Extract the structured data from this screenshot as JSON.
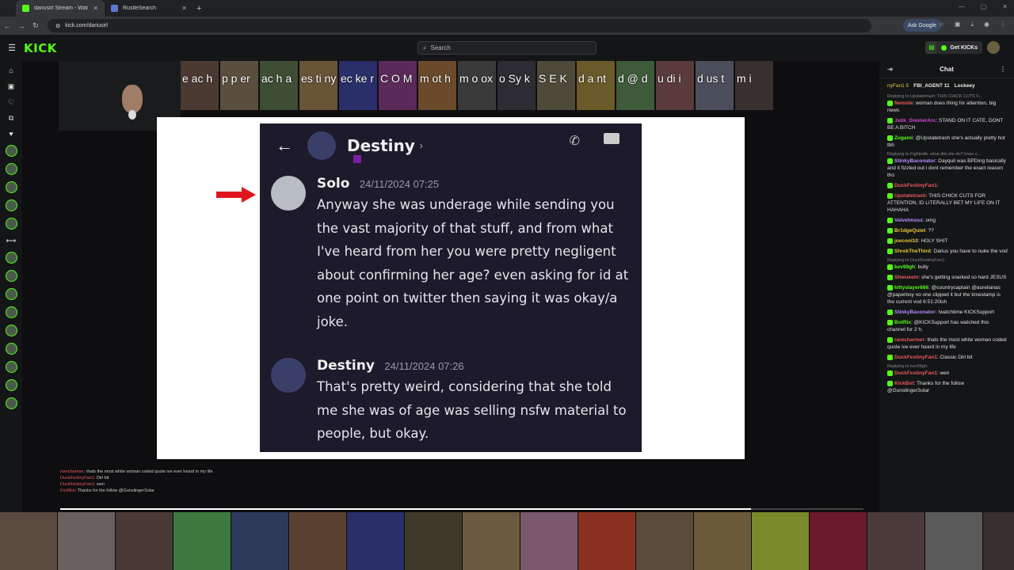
{
  "browser": {
    "tabs": [
      {
        "title": "dariusirl Stream - Watch Live o",
        "active": true
      },
      {
        "title": "RustleSearch",
        "active": false
      }
    ],
    "url": "kick.com/dariusirl",
    "ask_google": "Ask Google"
  },
  "kick": {
    "logo": "KICK",
    "search_placeholder": "Search",
    "get_kicks": "Get KICKs"
  },
  "stream": {
    "top_strip_letters": [
      "e ac h",
      "p p er",
      "ac h a",
      "es ti ny",
      "ec ke r",
      "C O M",
      "m ot h",
      "m o ox",
      "o Sy k",
      "S E K",
      "d a nt",
      "d @ d",
      "u di i",
      "d us t",
      "m i"
    ],
    "discord": {
      "header_name": "Destiny",
      "messages": [
        {
          "author": "Solo",
          "time": "24/11/2024 07:25",
          "text": "Anyway she was underage while sending you the vast majority of that stuff, and from what I've heard from her you were pretty negligent about confirming her age? even asking for id at one point on twitter then saying it was okay/a joke."
        },
        {
          "author": "Destiny",
          "time": "24/11/2024 07:26",
          "text": "That's pretty weird, considering that she told me she was of age was selling nsfw material to people, but okay."
        }
      ]
    },
    "overlay_chat": [
      {
        "user": "rarecharmer",
        "text": ": thats the most white woman coded quote ive ever heard in my life"
      },
      {
        "user": "DuckFestinyFan1",
        "text": ": Dirl bit"
      },
      {
        "user": "DuckFestinyFan1",
        "text": ": wen"
      },
      {
        "user": "KickBot",
        "text": ": Thanks for the follow @GunslingerSolar"
      }
    ],
    "progress": 0.86
  },
  "chat": {
    "title": "Chat",
    "pinned": [
      "nyFan1 5",
      "FBI_AGENT 11",
      "Lockeey"
    ],
    "messages": [
      {
        "reply": "Replying to Upstatetrash: THIS CHICK CUTS F...",
        "user": "Nemole",
        "color": "#e95a5a",
        "text": "woman does thing for attention, big news"
      },
      {
        "reply": "",
        "user": "Jstik_GoonerArc",
        "color": "#d14ad1",
        "text": "STAND ON IT CATE, DONT BE A BITCH"
      },
      {
        "reply": "",
        "user": "Zugami",
        "color": "#53fc18",
        "text": "@Upstatetrash she's actually pretty hot tbh"
      },
      {
        "reply": "Replying to Fightmilk: what did she do? lmao s...",
        "user": "StinkyBaconator",
        "color": "#b98aff",
        "text": "Dayquil was BPDing basically and it fizzled out i dont remember the exact reason tho"
      },
      {
        "reply": "",
        "user": "DuckFestinyFan1",
        "color": "#e95a5a",
        "text": ""
      },
      {
        "reply": "",
        "user": "Upstatetrash",
        "color": "#e95a5a",
        "text": "THIS CHICK CUTS FOR ATTENTION, ID LITERALLY BET MY LIFE ON IT HAHAHA"
      },
      {
        "reply": "",
        "user": "Velvetmoss",
        "color": "#b98aff",
        "text": "omg"
      },
      {
        "reply": "",
        "user": "Br1dgeQuiet",
        "color": "#e6c83a",
        "text": "??"
      },
      {
        "reply": "",
        "user": "joecool10",
        "color": "#e6c83a",
        "text": "HOLY SHIT"
      },
      {
        "reply": "",
        "user": "ShrekTheThird",
        "color": "#e6c83a",
        "text": "Darius you have to nuke the vod"
      },
      {
        "reply": "Replying to DuckFestinyFan1:",
        "user": "kev99gh",
        "color": "#53fc18",
        "text": "bully"
      },
      {
        "reply": "",
        "user": "Shwueem",
        "color": "#e95a5a",
        "text": "she's getting snarked so hard JESUS"
      },
      {
        "reply": "",
        "user": "kittyslayer666",
        "color": "#53fc18",
        "text": "@countrycaptain @aurelianas @paperboy no one clipped it but the timestamp is the current vod 6:51:20ish"
      },
      {
        "reply": "",
        "user": "StinkyBaconator",
        "color": "#b98aff",
        "text": "!watchtime KICKSupport"
      },
      {
        "reply": "",
        "user": "BotRix",
        "color": "#53fc18",
        "text": "@KICKSupport has watched this channel for 2 h."
      },
      {
        "reply": "",
        "user": "rarecharmer",
        "color": "#e95a5a",
        "text": "thats the most white woman coded quote ive ever heard in my life"
      },
      {
        "reply": "",
        "user": "DuckFestinyFan1",
        "color": "#e95a5a",
        "text": "Classic Dirl bit"
      },
      {
        "reply": "Replying to kev99gh:",
        "user": "DuckFestinyFan1",
        "color": "#e95a5a",
        "text": "wen"
      },
      {
        "reply": "",
        "user": "KickBot",
        "color": "#e95a5a",
        "text": "Thanks for the follow @GunslingerSolar"
      }
    ]
  },
  "colors": {
    "accent": "#53fc18",
    "discord_bg": "#1c1a2b",
    "arrow": "#e0141c"
  }
}
